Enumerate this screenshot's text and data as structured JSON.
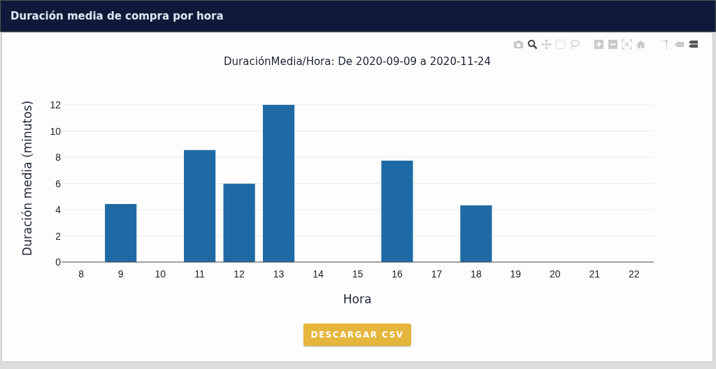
{
  "header": {
    "title": "Duración media de compra por hora"
  },
  "chart": {
    "chart_data": {
      "type": "bar",
      "title": "DuraciónMedia/Hora: De 2020-09-09 a 2020-11-24",
      "xlabel": "Hora",
      "ylabel": "Duración media (minutos)",
      "categories": [
        "8",
        "9",
        "10",
        "11",
        "12",
        "13",
        "14",
        "15",
        "16",
        "17",
        "18",
        "19",
        "20",
        "21",
        "22"
      ],
      "series": [
        {
          "color": "#1f6aa5",
          "values": [
            0,
            4.43,
            0,
            8.55,
            5.98,
            12,
            0,
            0,
            7.74,
            0,
            4.33,
            0,
            0,
            0,
            0
          ]
        }
      ],
      "ylim": [
        0,
        12
      ],
      "grid": true,
      "yticks": [
        0,
        2,
        4,
        6,
        8,
        10,
        12
      ]
    }
  },
  "button": {
    "label": "DESCARGAR CSV"
  }
}
